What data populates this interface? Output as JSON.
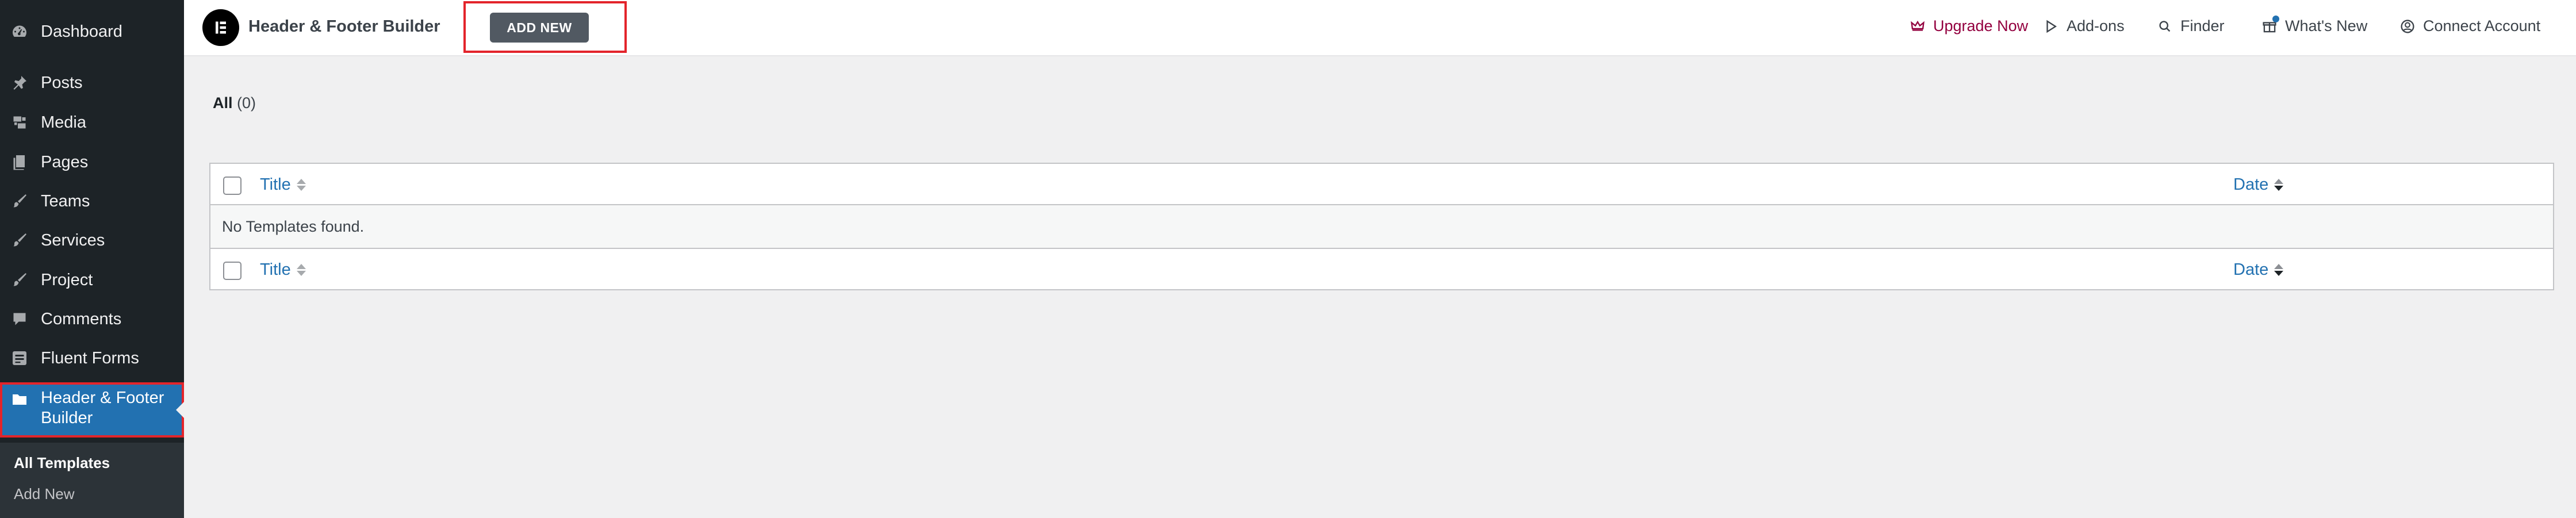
{
  "sidebar": {
    "items": [
      {
        "label": "Dashboard",
        "icon": "dashboard-icon"
      },
      {
        "label": "Posts",
        "icon": "pin-icon"
      },
      {
        "label": "Media",
        "icon": "media-icon"
      },
      {
        "label": "Pages",
        "icon": "pages-icon"
      },
      {
        "label": "Teams",
        "icon": "brush-icon"
      },
      {
        "label": "Services",
        "icon": "brush-icon"
      },
      {
        "label": "Project",
        "icon": "brush-icon"
      },
      {
        "label": "Comments",
        "icon": "comment-icon"
      },
      {
        "label": "Fluent Forms",
        "icon": "form-icon"
      },
      {
        "label": "Header & Footer Builder",
        "icon": "folder-icon",
        "active": true
      }
    ],
    "submenu": [
      {
        "label": "All Templates",
        "current": true
      },
      {
        "label": "Add New"
      }
    ]
  },
  "topbar": {
    "app_title": "Header & Footer Builder",
    "add_new_label": "ADD NEW",
    "links": [
      {
        "label": "Upgrade Now",
        "icon": "crown-icon"
      },
      {
        "label": "Add-ons",
        "icon": "play-icon"
      },
      {
        "label": "Finder",
        "icon": "search-icon"
      },
      {
        "label": "What's New",
        "icon": "gift-icon"
      },
      {
        "label": "Connect Account",
        "icon": "user-circle-icon"
      }
    ]
  },
  "main": {
    "views": {
      "all_label": "All",
      "all_count": "(0)"
    },
    "table": {
      "columns": [
        "Title",
        "Date"
      ],
      "empty_message": "No Templates found."
    }
  },
  "colors": {
    "sidebar_bg": "#1d2327",
    "active_menu": "#2271b1",
    "highlight_border": "#e3242b",
    "link": "#2271b1",
    "upgrade": "#93003f"
  }
}
